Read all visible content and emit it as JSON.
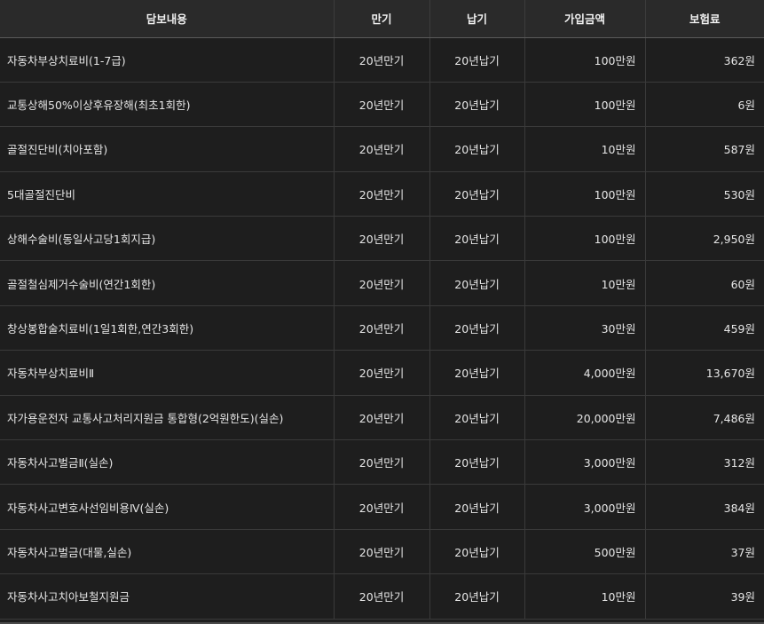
{
  "table": {
    "headers": [
      "담보내용",
      "만기",
      "납기",
      "가입금액",
      "보험료"
    ],
    "rows": [
      {
        "coverage": "자동차부상치료비(1-7급)",
        "term": "20년만기",
        "pay": "20년납기",
        "amount": "100만원",
        "premium": "362원"
      },
      {
        "coverage": "교통상해50%이상후유장해(최초1회한)",
        "term": "20년만기",
        "pay": "20년납기",
        "amount": "100만원",
        "premium": "6원"
      },
      {
        "coverage": "골절진단비(치아포함)",
        "term": "20년만기",
        "pay": "20년납기",
        "amount": "10만원",
        "premium": "587원"
      },
      {
        "coverage": "5대골절진단비",
        "term": "20년만기",
        "pay": "20년납기",
        "amount": "100만원",
        "premium": "530원"
      },
      {
        "coverage": "상해수술비(동일사고당1회지급)",
        "term": "20년만기",
        "pay": "20년납기",
        "amount": "100만원",
        "premium": "2,950원"
      },
      {
        "coverage": "골절철심제거수술비(연간1회한)",
        "term": "20년만기",
        "pay": "20년납기",
        "amount": "10만원",
        "premium": "60원"
      },
      {
        "coverage": "창상봉합술치료비(1일1회한,연간3회한)",
        "term": "20년만기",
        "pay": "20년납기",
        "amount": "30만원",
        "premium": "459원"
      },
      {
        "coverage": "자동차부상치료비Ⅱ",
        "term": "20년만기",
        "pay": "20년납기",
        "amount": "4,000만원",
        "premium": "13,670원"
      },
      {
        "coverage": "자가용운전자 교통사고처리지원금 통합형(2억원한도)(실손)",
        "term": "20년만기",
        "pay": "20년납기",
        "amount": "20,000만원",
        "premium": "7,486원"
      },
      {
        "coverage": "자동차사고벌금Ⅱ(실손)",
        "term": "20년만기",
        "pay": "20년납기",
        "amount": "3,000만원",
        "premium": "312원"
      },
      {
        "coverage": "자동차사고변호사선임비용Ⅳ(실손)",
        "term": "20년만기",
        "pay": "20년납기",
        "amount": "3,000만원",
        "premium": "384원"
      },
      {
        "coverage": "자동차사고벌금(대물,실손)",
        "term": "20년만기",
        "pay": "20년납기",
        "amount": "500만원",
        "premium": "37원"
      },
      {
        "coverage": "자동차사고치아보철지원금",
        "term": "20년만기",
        "pay": "20년납기",
        "amount": "10만원",
        "premium": "39원"
      }
    ]
  },
  "colors": {
    "background": "#1e1e1e",
    "header_bg": "#2a2a2a",
    "text": "#e6e6e6",
    "border": "#3a3a3a"
  }
}
